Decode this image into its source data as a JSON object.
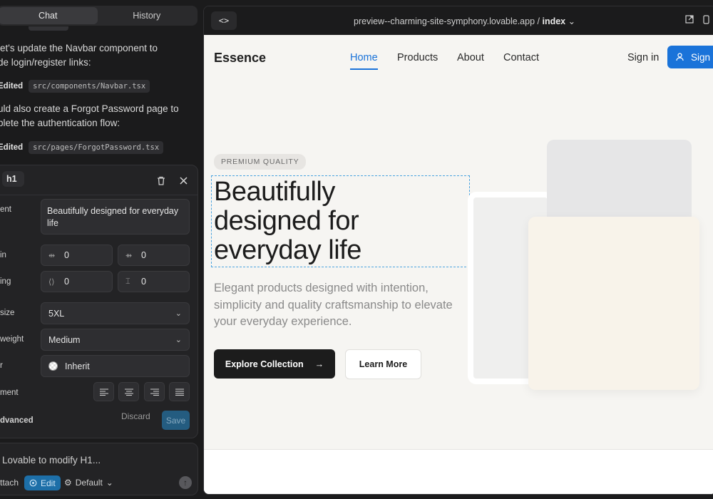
{
  "sidebar": {
    "tabs": [
      {
        "label": "Chat"
      },
      {
        "label": "History"
      }
    ],
    "messages": [
      {
        "line1": "let's update the Navbar component to",
        "line2": "de login/register links:"
      },
      {
        "line1": "uld also create a Forgot Password page to",
        "line2": "plete the authentication flow:"
      }
    ],
    "edits": [
      {
        "label": "Edited",
        "file": "src/components/Navbar.tsx"
      },
      {
        "label": "Edited",
        "file": "src/pages/ForgotPassword.tsx"
      }
    ]
  },
  "editor": {
    "tag": "h1",
    "labels": {
      "content": "ent",
      "margin": "in",
      "padding": "ing",
      "size": "size",
      "weight": "weight",
      "color": "r",
      "alignment": "ment",
      "advanced": "dvanced"
    },
    "content_value": "Beautifully designed for everyday life",
    "margin_values": [
      "0",
      "0"
    ],
    "padding_values": [
      "0",
      "0"
    ],
    "size_value": "5XL",
    "weight_value": "Medium",
    "color_value": "Inherit",
    "discard_label": "Discard",
    "save_label": "Save"
  },
  "prompt": {
    "placeholder": "Lovable to modify H1...",
    "attach_label": "ttach",
    "edit_label": "Edit",
    "default_label": "Default"
  },
  "preview": {
    "url_prefix": "preview--charming-site-symphony.lovable.app / ",
    "url_page": "index"
  },
  "site": {
    "brand": "Essence",
    "nav": [
      "Home",
      "Products",
      "About",
      "Contact"
    ],
    "signin": "Sign in",
    "signup": "Sign",
    "badge": "PREMIUM QUALITY",
    "headline_lines": [
      "Beautifully",
      "designed for",
      "everyday life"
    ],
    "subheading": "Elegant products designed with intention, simplicity and quality craftsmanship to elevate your everyday experience.",
    "primary_cta": "Explore Collection",
    "secondary_cta": "Learn More"
  },
  "colors": {
    "accent": "#1a73d9",
    "save_button": "#245c80",
    "edit_chip": "#1d6fa8",
    "site_bg": "#f6f5f2",
    "selection_outline": "#4aa3df"
  }
}
